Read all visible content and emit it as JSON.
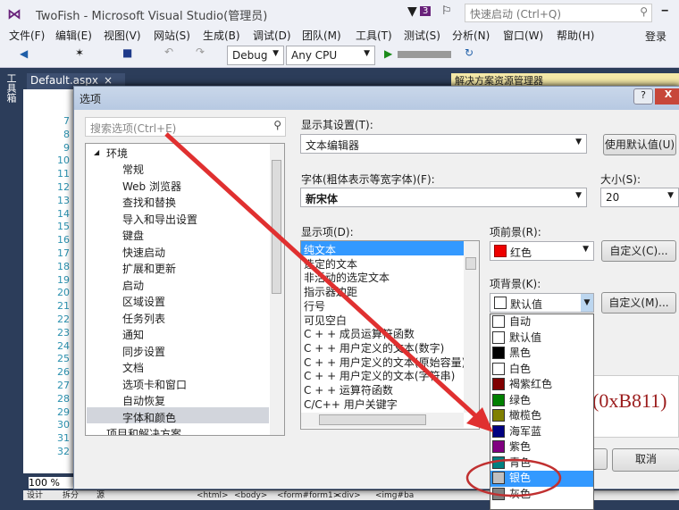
{
  "window": {
    "title": "TwoFish - Microsoft Visual Studio(管理员)",
    "notification_count": "3",
    "quick_launch_placeholder": "快速启动 (Ctrl+Q)",
    "login": "登录"
  },
  "menu": [
    "文件(F)",
    "编辑(E)",
    "视图(V)",
    "网站(S)",
    "生成(B)",
    "调试(D)",
    "团队(M)",
    "工具(T)",
    "测试(S)",
    "分析(N)",
    "窗口(W)",
    "帮助(H)"
  ],
  "toolbar": {
    "config": "Debug",
    "platform": "Any CPU"
  },
  "editor": {
    "tab": "Default.aspx",
    "side_tab": "工具箱",
    "line_numbers": [
      "7",
      "8",
      "9",
      "10",
      "11",
      "12",
      "13",
      "14",
      "15",
      "16",
      "17",
      "18",
      "19",
      "20",
      "21",
      "22",
      "23",
      "24",
      "25",
      "26",
      "27",
      "28",
      "29",
      "30",
      "31",
      "32"
    ],
    "zoom": "100 %",
    "solution_explorer": "解决方案资源管理器",
    "status_tabs": [
      "设计",
      "拆分",
      "源",
      "<html>",
      "<body>",
      "<form#form1>",
      "<div>",
      "<img#ba"
    ]
  },
  "dialog": {
    "title": "选项",
    "search_placeholder": "搜索选项(Ctrl+E)",
    "tree": {
      "root": "环境",
      "items": [
        "常规",
        "Web 浏览器",
        "查找和替换",
        "导入和导出设置",
        "键盘",
        "快速启动",
        "扩展和更新",
        "启动",
        "区域设置",
        "任务列表",
        "通知",
        "同步设置",
        "文档",
        "选项卡和窗口",
        "自动恢复",
        "字体和颜色"
      ],
      "selected": "字体和颜色",
      "next_root": "项目和解决方案"
    },
    "show_settings_label": "显示其设置(T):",
    "show_settings_value": "文本编辑器",
    "use_default_button": "使用默认值(U)",
    "font_label": "字体(粗体表示等宽字体)(F):",
    "font_value": "新宋体",
    "size_label": "大小(S):",
    "size_value": "20",
    "display_items_label": "显示项(D):",
    "display_items": [
      "纯文本",
      "选定的文本",
      "非活动的选定文本",
      "指示器边距",
      "行号",
      "可见空白",
      "C + + 成员运算符函数",
      "C + + 用户定义的文本(数字)",
      "C + + 用户定义的文本(原始容量)",
      "C + + 用户定义的文本(字符串)",
      "C + + 运算符函数",
      "C/C++ 用户关键字"
    ],
    "display_selected": "纯文本",
    "fg_label": "项前景(R):",
    "fg_value": "红色",
    "fg_color": "#ee0000",
    "fg_custom_button": "自定义(C)...",
    "bg_label": "项背景(K):",
    "bg_value": "默认值",
    "bg_custom_button": "自定义(M)...",
    "bg_options": [
      {
        "name": "自动",
        "color": "#ffffff"
      },
      {
        "name": "默认值",
        "color": "#ffffff"
      },
      {
        "name": "黑色",
        "color": "#000000"
      },
      {
        "name": "白色",
        "color": "#ffffff"
      },
      {
        "name": "褐紫红色",
        "color": "#800000"
      },
      {
        "name": "绿色",
        "color": "#008000"
      },
      {
        "name": "橄榄色",
        "color": "#808000"
      },
      {
        "name": "海军蓝",
        "color": "#000080"
      },
      {
        "name": "紫色",
        "color": "#800080"
      },
      {
        "name": "青色",
        "color": "#008080"
      },
      {
        "name": "银色",
        "color": "#c0c0c0"
      },
      {
        "name": "灰色",
        "color": "#808080"
      }
    ],
    "bg_highlighted": "银色",
    "sample_text": "(0xB811)",
    "cancel_button": "取消",
    "help_button": "?",
    "close_button": "X"
  },
  "colors": {
    "selection": "#3399ff",
    "annotation_red": "#e03030"
  }
}
